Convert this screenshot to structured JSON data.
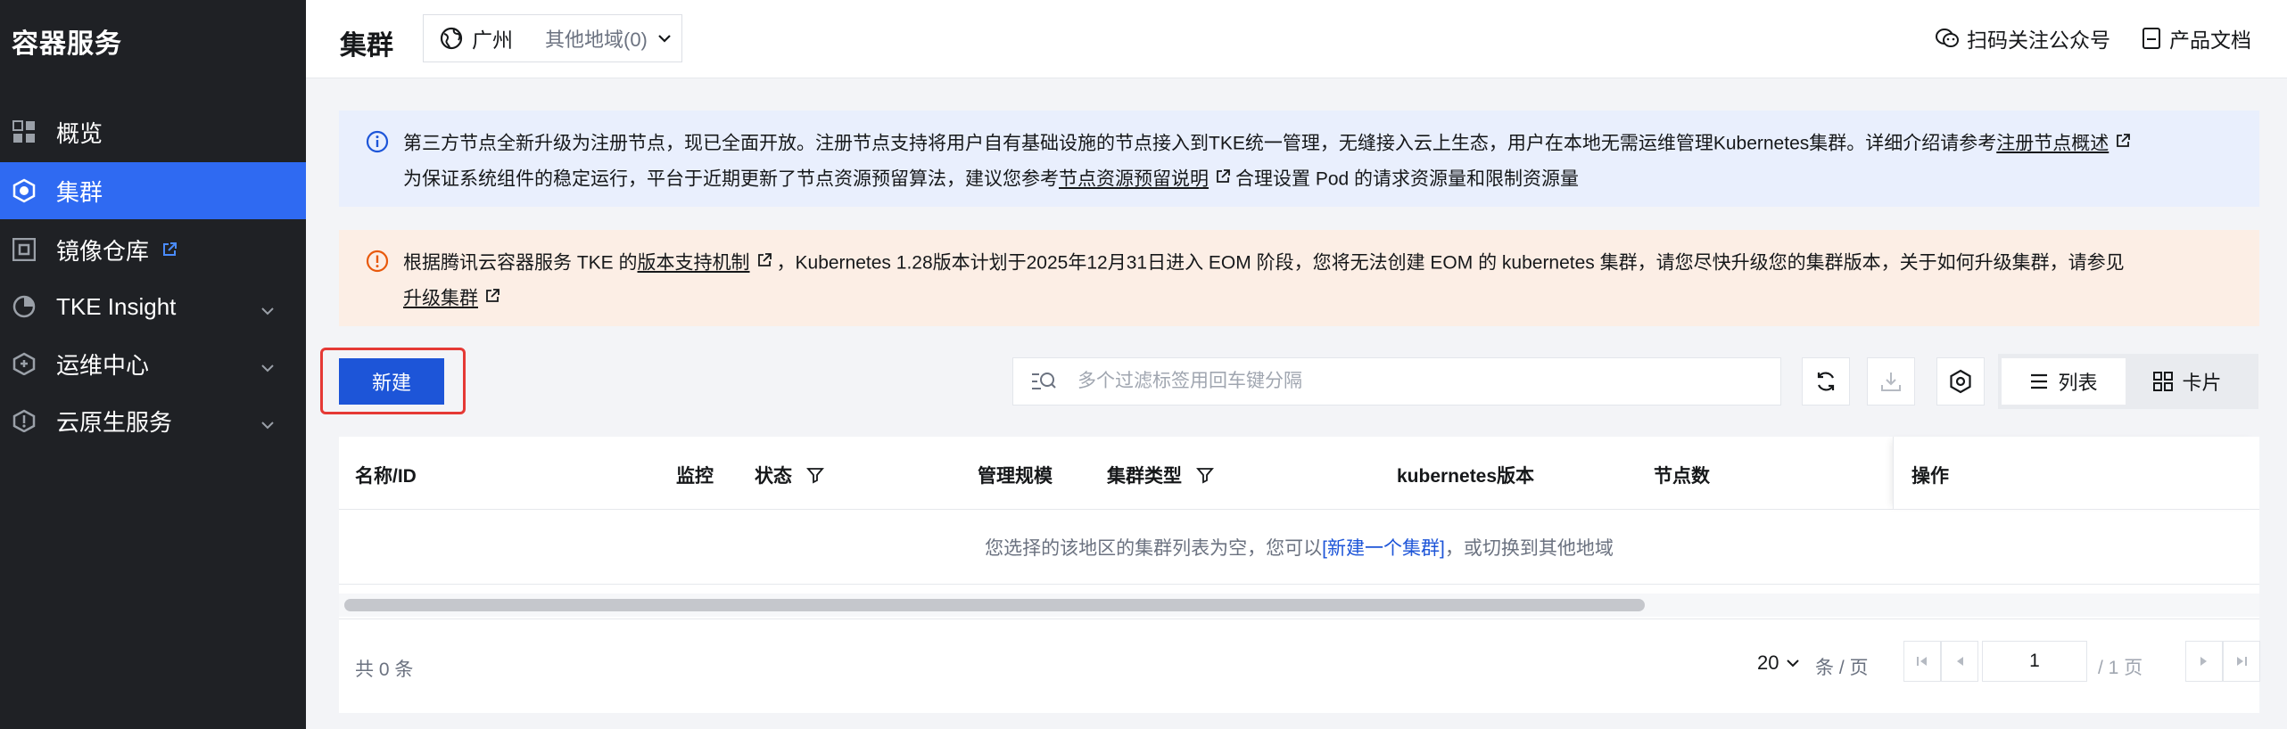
{
  "sidebar": {
    "brand": "容器服务",
    "items": [
      {
        "label": "概览",
        "icon": "dashboard-icon"
      },
      {
        "label": "集群",
        "icon": "cluster-icon",
        "active": true
      },
      {
        "label": "镜像仓库",
        "icon": "registry-icon",
        "external": true
      },
      {
        "label": "TKE Insight",
        "icon": "insight-icon",
        "expandable": true
      },
      {
        "label": "运维中心",
        "icon": "ops-center-icon",
        "expandable": true
      },
      {
        "label": "云原生服务",
        "icon": "cloud-native-icon",
        "expandable": true
      }
    ]
  },
  "header": {
    "title": "集群",
    "region": "广州",
    "other_regions": "其他地域(0)",
    "follow_link": "扫码关注公众号",
    "docs_link": "产品文档"
  },
  "alerts": {
    "info": {
      "part1": "第三方节点全新升级为注册节点，现已全面开放。注册节点支持将用户自有基础设施的节点接入到TKE统一管理，无缝接入云上生态，用户在本地无需运维管理Kubernetes集群。详细介绍请参考",
      "link1": "注册节点概述",
      "part2": "为保证系统组件的稳定运行，平台于近期更新了节点资源预留算法，建议您参考",
      "link2": "节点资源预留说明",
      "part3": "合理设置 Pod 的请求资源量和限制资源量"
    },
    "warning": {
      "part1": "根据腾讯云容器服务 TKE 的",
      "link1": "版本支持机制",
      "part2": "，Kubernetes 1.28版本计划于2025年12月31日进入 EOM 阶段，您将无法创建 EOM 的 kubernetes 集群，请您尽快升级您的集群版本，关于如何升级集群，请参见",
      "link2": "升级集群"
    }
  },
  "toolbar": {
    "new_button": "新建",
    "search_placeholder": "多个过滤标签用回车键分隔",
    "view_list": "列表",
    "view_card": "卡片"
  },
  "table": {
    "columns": [
      "名称/ID",
      "监控",
      "状态",
      "管理规模",
      "集群类型",
      "kubernetes版本",
      "节点数",
      "操作"
    ],
    "empty_prefix": "您选择的该地区的集群列表为空，您可以",
    "empty_link": "[新建一个集群]",
    "empty_suffix": "，或切换到其他地域"
  },
  "pager": {
    "total": "共 0 条",
    "page_size": "20",
    "per_page": "条 / 页",
    "current_page": "1",
    "page_count": "/ 1 页"
  }
}
